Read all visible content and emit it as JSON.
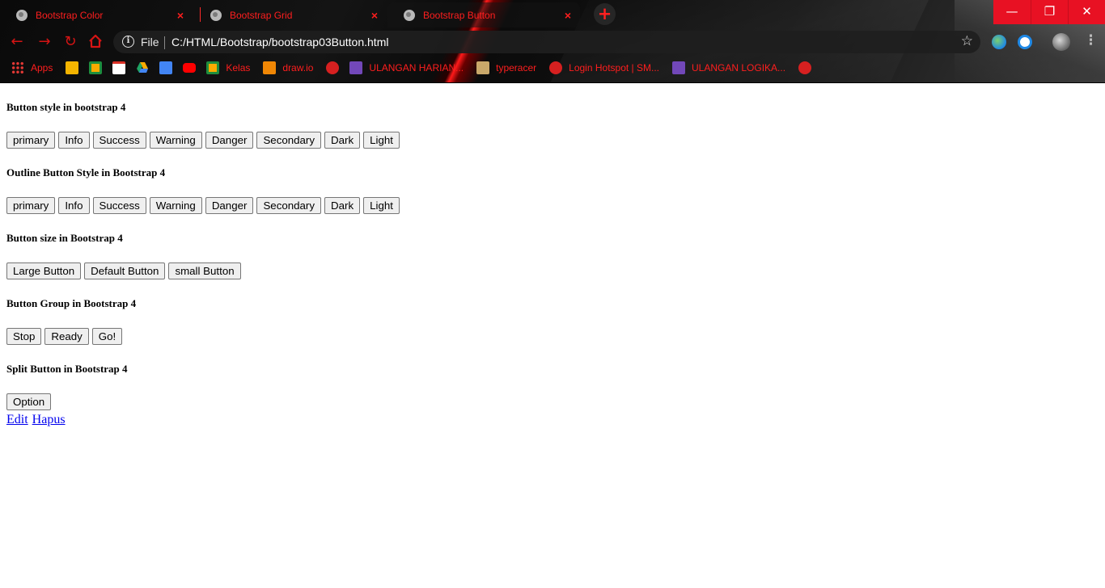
{
  "browser": {
    "tabs": [
      {
        "title": "Bootstrap Color",
        "active": false
      },
      {
        "title": "Bootstrap Grid",
        "active": false
      },
      {
        "title": "Bootstrap Button",
        "active": true
      }
    ],
    "new_tab_symbol": "+",
    "window_controls": {
      "minimize": "—",
      "restore": "❐",
      "close": "✕"
    },
    "omnibox": {
      "security_label": "File",
      "url": "C:/HTML/Bootstrap/bootstrap03Button.html"
    },
    "bookmarks": [
      {
        "label": "Apps",
        "icon": "apps-grid-icon",
        "color": "#e53935"
      },
      {
        "label": "",
        "icon": "google-keep-icon",
        "color": "#f4b400"
      },
      {
        "label": "",
        "icon": "google-classroom-icon",
        "color": "#f9ab00"
      },
      {
        "label": "",
        "icon": "gmail-icon",
        "color": "#d93025"
      },
      {
        "label": "",
        "icon": "google-drive-icon",
        "color": "#1fa463"
      },
      {
        "label": "",
        "icon": "google-docs-icon",
        "color": "#4285f4"
      },
      {
        "label": "",
        "icon": "youtube-icon",
        "color": "#ff0000"
      },
      {
        "label": "Kelas",
        "icon": "google-classroom-icon",
        "color": "#f9ab00"
      },
      {
        "label": "draw.io",
        "icon": "drawio-icon",
        "color": "#f08705"
      },
      {
        "label": "",
        "icon": "globe-icon",
        "color": "#d62020"
      },
      {
        "label": "ULANGAN HARIAN...",
        "icon": "google-forms-icon",
        "color": "#7248b9"
      },
      {
        "label": "typeracer",
        "icon": "typeracer-icon",
        "color": "#c9a86a"
      },
      {
        "label": "Login Hotspot | SM...",
        "icon": "globe-icon",
        "color": "#d62020"
      },
      {
        "label": "ULANGAN LOGIKA...",
        "icon": "google-forms-icon",
        "color": "#7248b9"
      },
      {
        "label": "",
        "icon": "globe-icon",
        "color": "#d62020"
      }
    ]
  },
  "page": {
    "sections": [
      {
        "heading": "Button style in bootstrap 4",
        "buttons": [
          "primary",
          "Info",
          "Success",
          "Warning",
          "Danger",
          "Secondary",
          "Dark",
          "Light"
        ]
      },
      {
        "heading": "Outline Button Style in Bootstrap 4",
        "buttons": [
          "primary",
          "Info",
          "Success",
          "Warning",
          "Danger",
          "Secondary",
          "Dark",
          "Light"
        ]
      },
      {
        "heading": "Button size in Bootstrap 4",
        "buttons": [
          "Large Button",
          "Default Button",
          "small Button"
        ]
      },
      {
        "heading": "Button Group in Bootstrap 4",
        "buttons": [
          "Stop",
          "Ready",
          "Go!"
        ]
      },
      {
        "heading": "Split Button in Bootstrap 4",
        "buttons": [
          "Option"
        ]
      }
    ],
    "links": [
      "Edit",
      "Hapus"
    ]
  }
}
